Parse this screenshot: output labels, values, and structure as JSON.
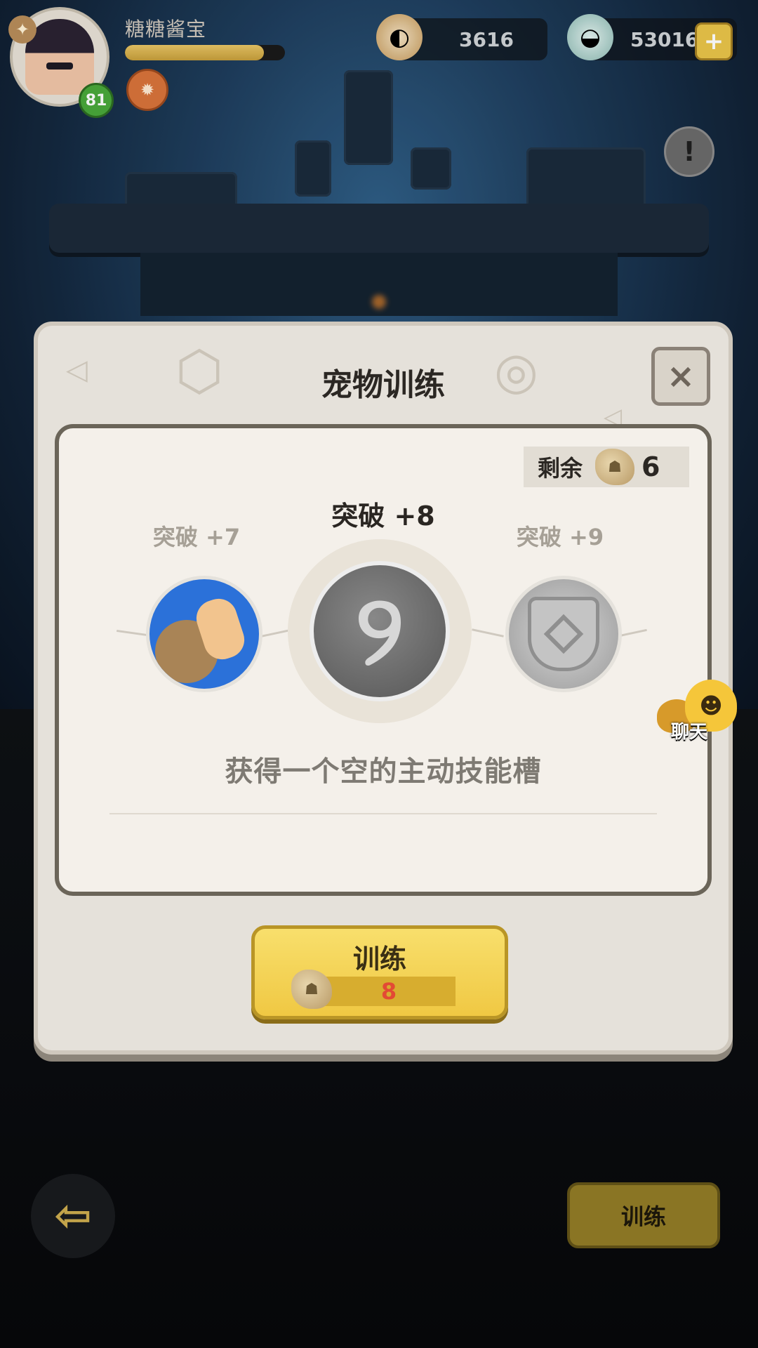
{
  "player": {
    "name": "糖糖酱宝",
    "level": "81",
    "xp_progress": 0.87
  },
  "currency": {
    "pearls": "3616",
    "shells": "53016"
  },
  "dialog": {
    "title": "宠物训练",
    "remaining_label": "剩余",
    "remaining_count": "6",
    "tiers": {
      "prev": "突破 +7",
      "current": "突破 +8",
      "next": "突破 +9"
    },
    "description": "获得一个空的主动技能槽",
    "train_button_label": "训练",
    "train_cost": "8"
  },
  "chat": {
    "label": "聊天"
  },
  "footer": {
    "train_button_label": "训练"
  },
  "colors": {
    "accent_gold": "#f0c843",
    "cost_red": "#e34a34",
    "level_green": "#49a83a"
  },
  "icons": [
    "crown-icon",
    "status-icon",
    "pearl-icon",
    "shell-icon",
    "plus-icon",
    "info-icon",
    "close-icon",
    "fossil-icon",
    "back-arrow-icon",
    "chat-icon"
  ]
}
